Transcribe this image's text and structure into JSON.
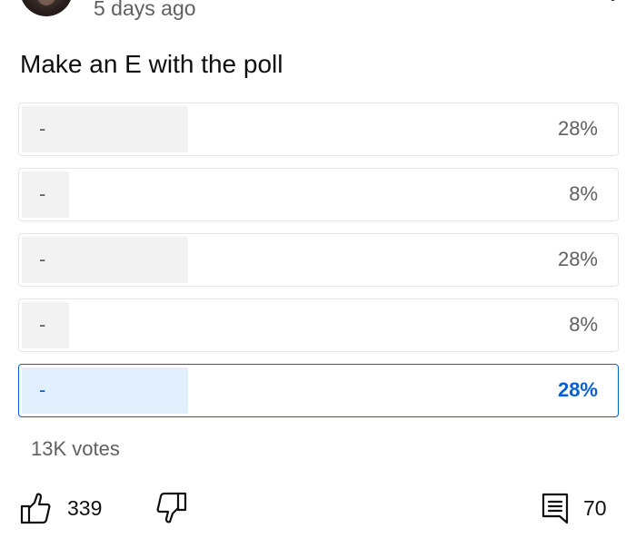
{
  "post": {
    "time_ago": "5 days ago",
    "text": "Make an E with the poll"
  },
  "poll": {
    "options": [
      {
        "label": "-",
        "percent": "28%",
        "fraction": 0.28,
        "selected": false
      },
      {
        "label": "-",
        "percent": "8%",
        "fraction": 0.08,
        "selected": false
      },
      {
        "label": "-",
        "percent": "28%",
        "fraction": 0.28,
        "selected": false
      },
      {
        "label": "-",
        "percent": "8%",
        "fraction": 0.08,
        "selected": false
      },
      {
        "label": "-",
        "percent": "28%",
        "fraction": 0.28,
        "selected": true
      }
    ],
    "votes": "13K votes"
  },
  "actions": {
    "like_count": "339",
    "comment_count": "70"
  },
  "colors": {
    "accent": "#065fd4",
    "selected_fill": "#e1effd",
    "bar_fill": "#f2f2f2",
    "secondary_text": "#606060"
  },
  "icons": {
    "avatar": "channel-avatar",
    "more": "more-vert-icon",
    "like": "thumbs-up-icon",
    "dislike": "thumbs-down-icon",
    "comment": "comment-icon"
  }
}
